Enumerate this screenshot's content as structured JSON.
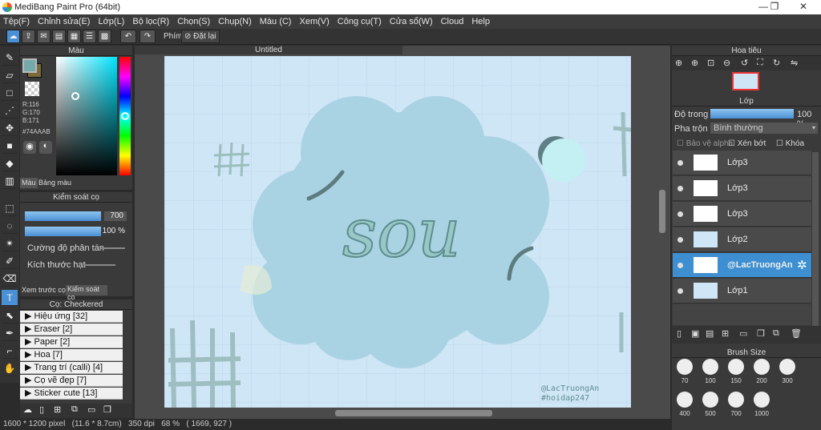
{
  "window": {
    "title": "MediBang Paint Pro (64bit)",
    "minimize": "—",
    "restore": "❐",
    "close": "✕"
  },
  "menu": [
    "Tệp(F)",
    "Chỉnh sửa(E)",
    "Lớp(L)",
    "Bộ lọc(R)",
    "Chọn(S)",
    "Chụp(N)",
    "Màu (C)",
    "Xem(V)",
    "Công cụ(T)",
    "Cửa sổ(W)",
    "Cloud",
    "Help"
  ],
  "toolbar": {
    "keys_label": "Phím",
    "reset_label": "Đặt lại"
  },
  "color_panel": {
    "title": "Màu",
    "r": "R:116",
    "g": "G:170",
    "b": "B:171",
    "hex": "#74AAAB",
    "tab_color": "Màu",
    "tab_palette": "Bảng màu",
    "fg_color": "#74aaab"
  },
  "brush_control": {
    "title": "Kiểm soát cọ",
    "size_value": "700",
    "opacity_value": "100 %",
    "scatter_label": "Cường độ phân tán",
    "grain_label": "Kích thước hạt",
    "tab_preview": "Xem trước cọ",
    "tab_control": "Kiểm soát cọ"
  },
  "brush_list": {
    "title": "Cọ: Checkered",
    "items": [
      "Hiệu ứng [32]",
      "Eraser [2]",
      "Paper [2]",
      "Hoa [7]",
      "Trang trí (calli) [4]",
      "Cọ vẽ đẹp [7]",
      "Sticker cute [13]"
    ]
  },
  "document": {
    "title": "Untitled",
    "art_text": "sou",
    "watermark_1": "@LacTruongAn",
    "watermark_2": "#hoidap247"
  },
  "navigator": {
    "title": "Hoa tiêu"
  },
  "layers": {
    "title": "Lớp",
    "opacity_label": "Độ trong",
    "opacity_value": "100 %",
    "blend_label": "Pha trộn",
    "blend_value": "Bình thường",
    "protect_alpha": "Bảo vệ alpha",
    "clip": "Xén bớt",
    "lock": "Khóa",
    "items": [
      {
        "name": "Lớp3",
        "selected": false
      },
      {
        "name": "Lớp3",
        "selected": false
      },
      {
        "name": "Lớp3",
        "selected": false
      },
      {
        "name": "Lớp2",
        "selected": false
      },
      {
        "name": "@LacTruongAn",
        "selected": true
      },
      {
        "name": "Lớp1",
        "selected": false
      }
    ]
  },
  "brush_size": {
    "title": "Brush Size",
    "sizes": [
      "70",
      "100",
      "150",
      "200",
      "300",
      "400",
      "500",
      "700",
      "1000"
    ]
  },
  "status": {
    "dimensions": "1600 * 1200 pixel",
    "physical": "(11.6 * 8.7cm)",
    "dpi": "350 dpi",
    "zoom": "68 %",
    "cursor": "( 1669, 927 )"
  }
}
